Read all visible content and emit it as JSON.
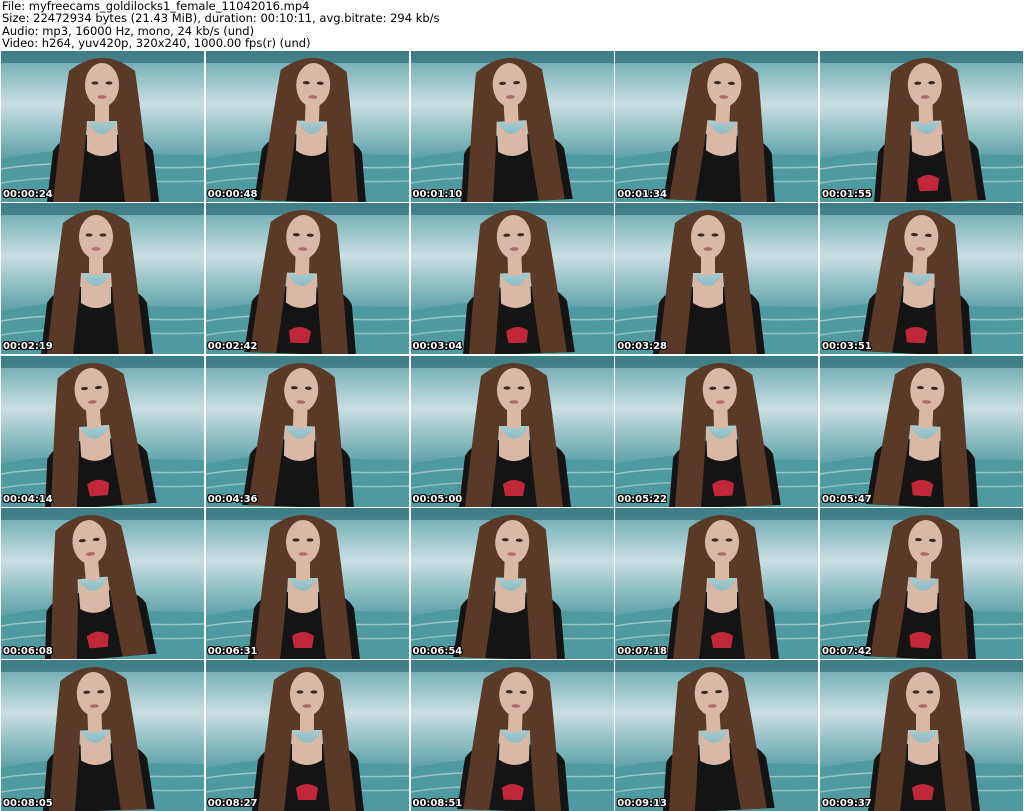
{
  "header": {
    "file_line": "File: myfreecams_goldilocks1_female_11042016.mp4",
    "size_line": "Size: 22472934 bytes (21.43 MiB), duration: 00:10:11, avg.bitrate: 294 kb/s",
    "audio_line": "Audio: mp3, 16000 Hz, mono, 24 kb/s (und)",
    "video_line": "Video: h264, yuv420p, 320x240, 1000.00 fps(r) (und)"
  },
  "thumbnails": [
    {
      "time": "00:00:24"
    },
    {
      "time": "00:00:48"
    },
    {
      "time": "00:01:10"
    },
    {
      "time": "00:01:34"
    },
    {
      "time": "00:01:55"
    },
    {
      "time": "00:02:19"
    },
    {
      "time": "00:02:42"
    },
    {
      "time": "00:03:04"
    },
    {
      "time": "00:03:28"
    },
    {
      "time": "00:03:51"
    },
    {
      "time": "00:04:14"
    },
    {
      "time": "00:04:36"
    },
    {
      "time": "00:05:00"
    },
    {
      "time": "00:05:22"
    },
    {
      "time": "00:05:47"
    },
    {
      "time": "00:06:08"
    },
    {
      "time": "00:06:31"
    },
    {
      "time": "00:06:54"
    },
    {
      "time": "00:07:18"
    },
    {
      "time": "00:07:42"
    },
    {
      "time": "00:08:05"
    },
    {
      "time": "00:08:27"
    },
    {
      "time": "00:08:51"
    },
    {
      "time": "00:09:13"
    },
    {
      "time": "00:09:37"
    }
  ],
  "colors": {
    "page_background": "#ffffff",
    "header_text": "#000000",
    "timestamp_text": "#ffffff",
    "backdrop_sky": "#c9dfe2",
    "backdrop_water": "#5fa3ac",
    "bedding": "#4f9aa0",
    "hair": "#5a3a26",
    "skin": "#d9b8a6",
    "top": "#141414",
    "accent": "#c0283a"
  }
}
